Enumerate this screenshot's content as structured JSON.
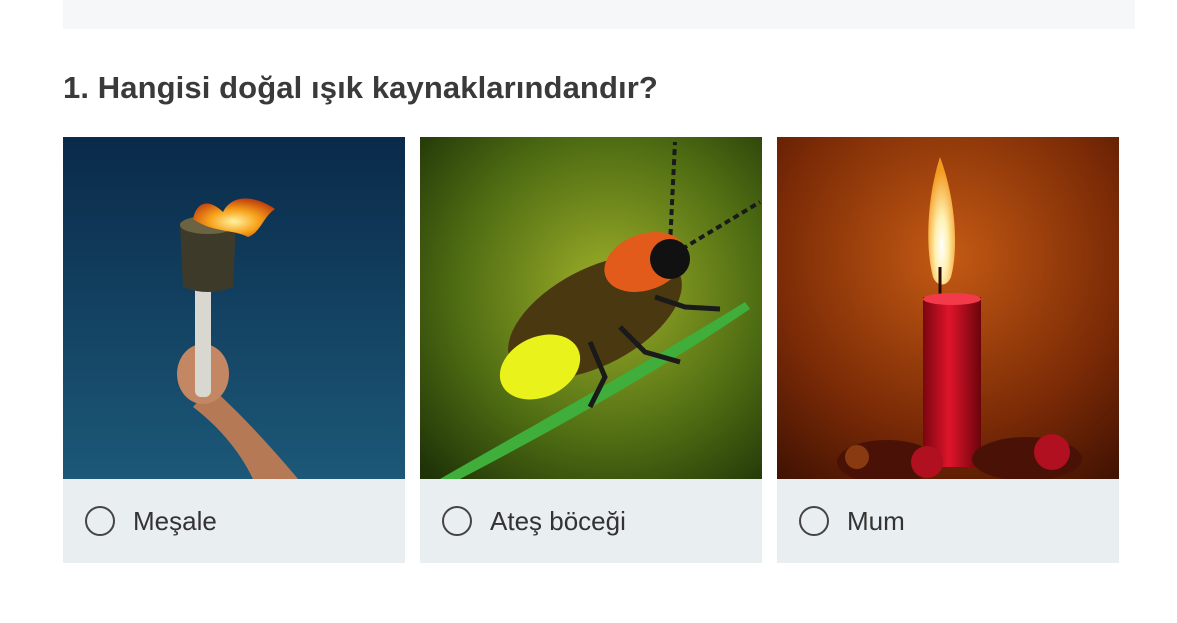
{
  "question": {
    "text": "1. Hangisi doğal ışık kaynaklarındandır?"
  },
  "options": [
    {
      "label": "Meşale",
      "image": "torch-image",
      "selected": false
    },
    {
      "label": "Ateş böceği",
      "image": "firefly-image",
      "selected": false
    },
    {
      "label": "Mum",
      "image": "candle-image",
      "selected": false
    }
  ],
  "colors": {
    "card_background": "#e9eef0",
    "question_text": "#3a3a3a",
    "label_text": "#333333"
  }
}
